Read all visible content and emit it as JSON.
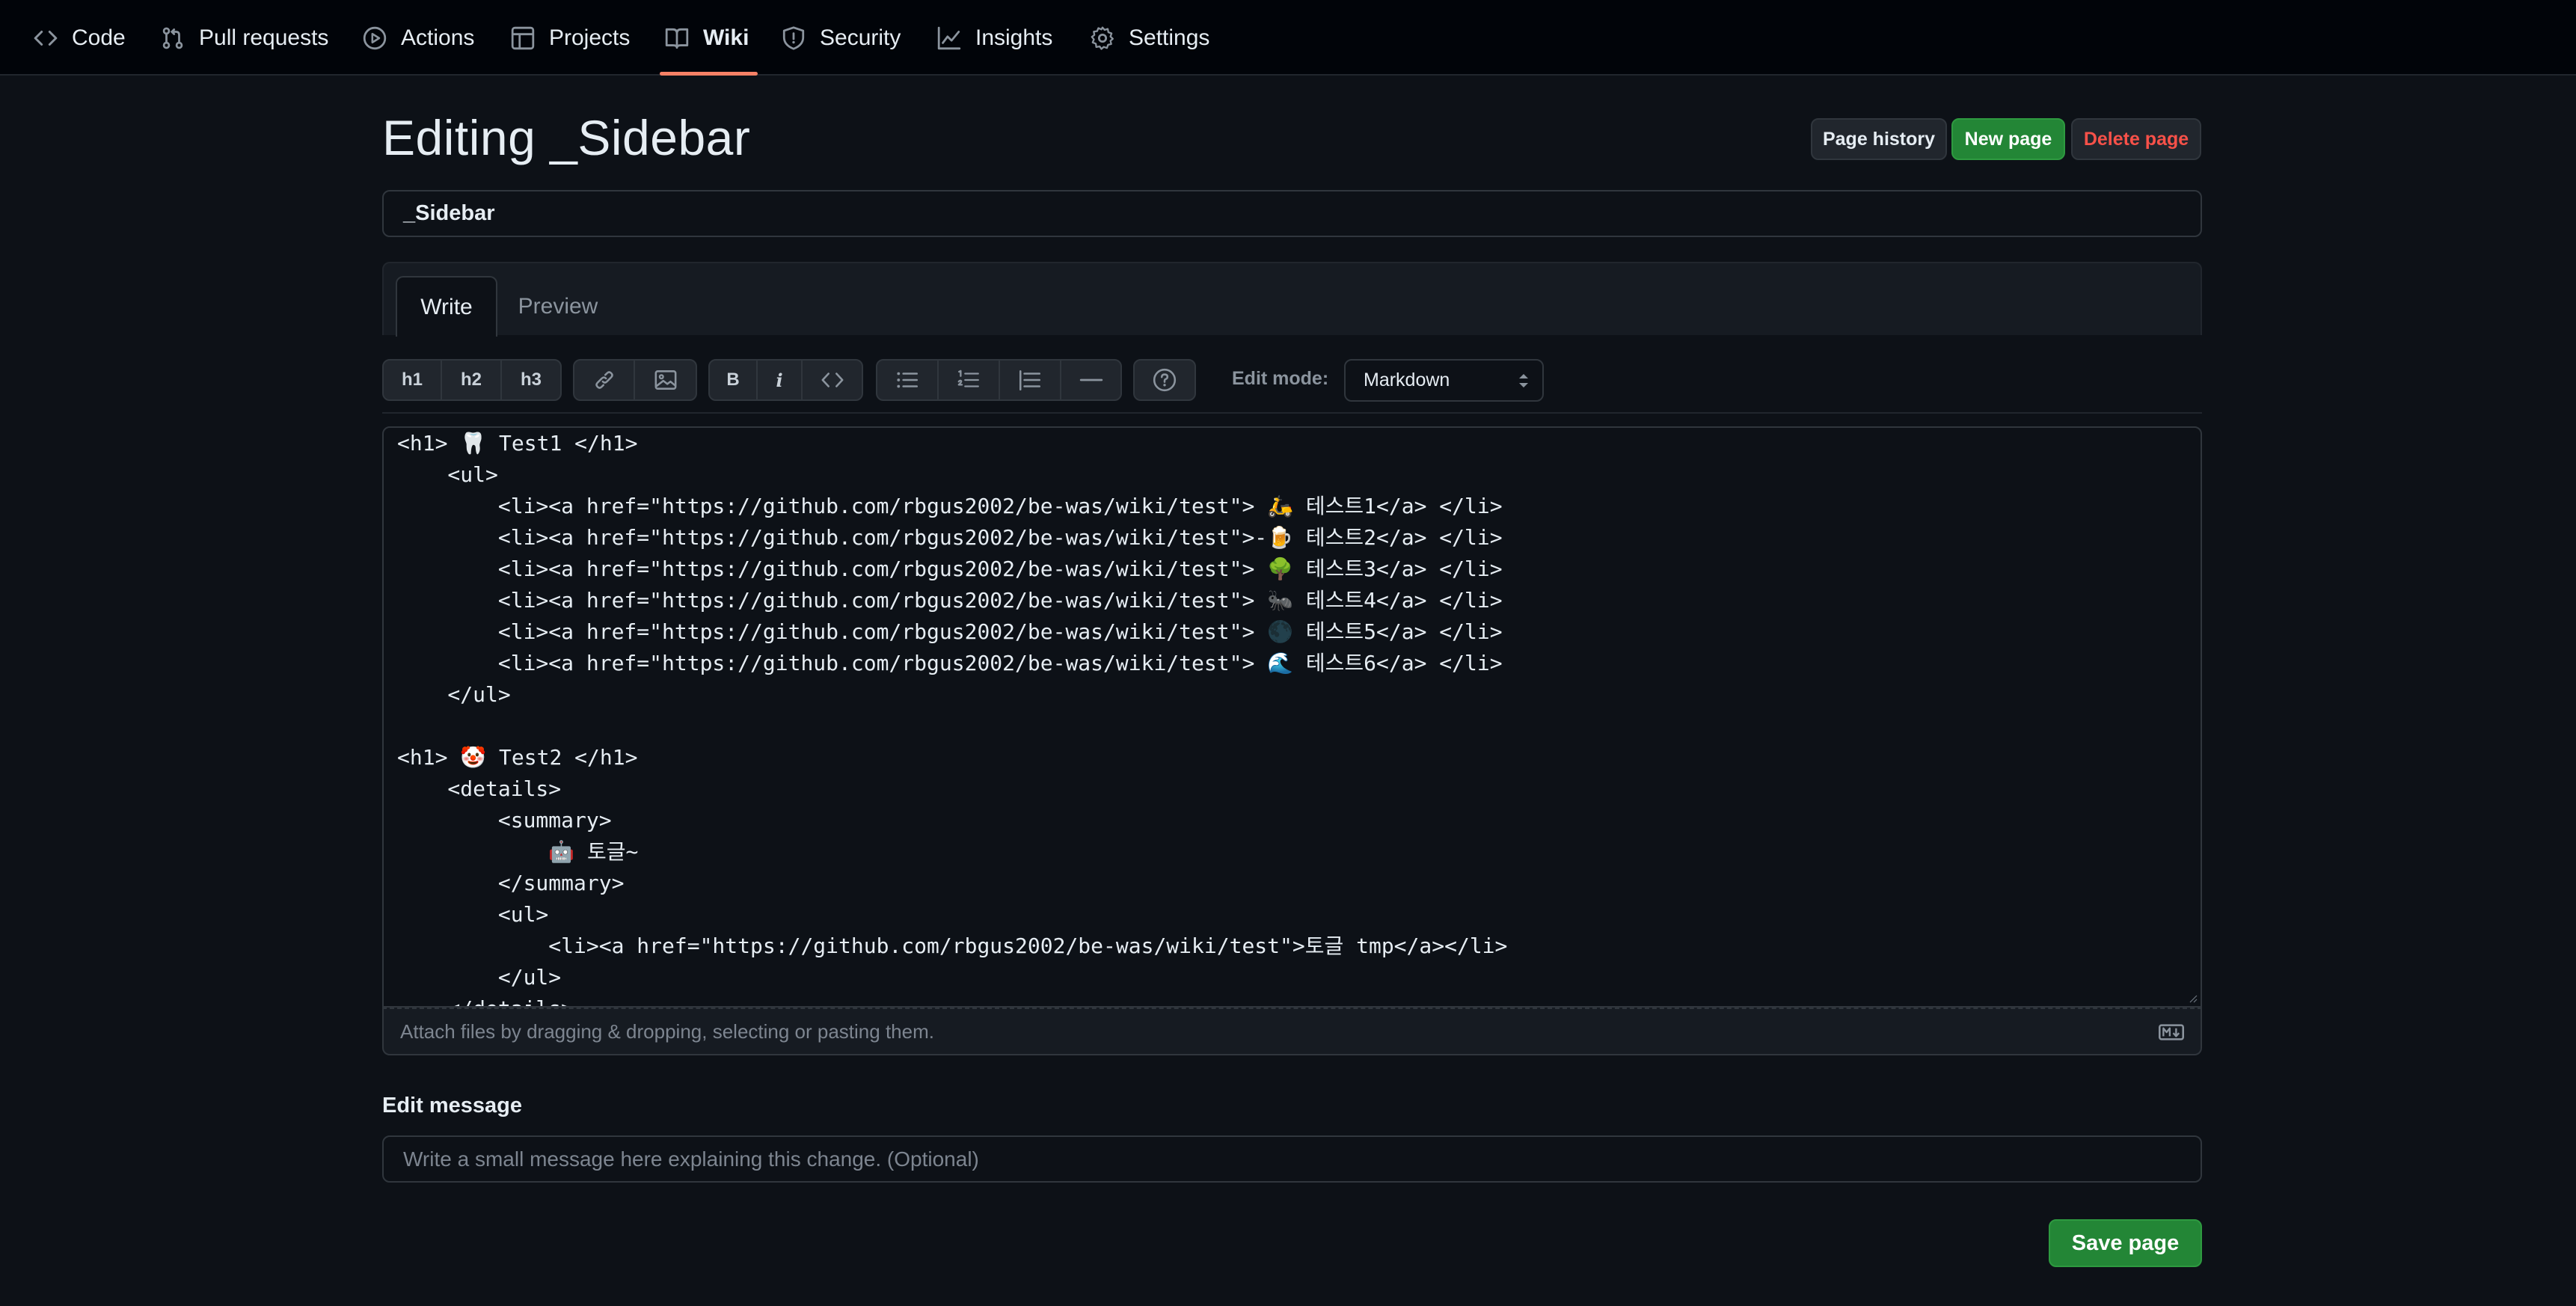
{
  "nav": {
    "items": [
      {
        "label": "Code",
        "icon": "code-icon"
      },
      {
        "label": "Pull requests",
        "icon": "pull-request-icon"
      },
      {
        "label": "Actions",
        "icon": "play-icon"
      },
      {
        "label": "Projects",
        "icon": "table-icon"
      },
      {
        "label": "Wiki",
        "icon": "book-icon",
        "active": true
      },
      {
        "label": "Security",
        "icon": "shield-icon"
      },
      {
        "label": "Insights",
        "icon": "graph-icon"
      },
      {
        "label": "Settings",
        "icon": "gear-icon"
      }
    ],
    "active_color": "#f78166"
  },
  "header": {
    "title": "Editing _Sidebar",
    "page_history": "Page history",
    "new_page": "New page",
    "delete_page": "Delete page"
  },
  "page_name": "_Sidebar",
  "tabs": {
    "write": "Write",
    "preview": "Preview"
  },
  "toolbar": {
    "h1": "h1",
    "h2": "h2",
    "h3": "h3",
    "bold": "B",
    "italic": "i",
    "edit_mode_label": "Edit mode:",
    "edit_mode_value": "Markdown"
  },
  "editor": {
    "lines": [
      "<h1> 🦷 Test1 </h1>",
      "    <ul>",
      "        <li><a href=\"https://github.com/rbgus2002/be-was/wiki/test\"> 🛵 테스트1</a> </li>",
      "        <li><a href=\"https://github.com/rbgus2002/be-was/wiki/test\">-🍺 테스트2</a> </li>",
      "        <li><a href=\"https://github.com/rbgus2002/be-was/wiki/test\"> 🌳 테스트3</a> </li>",
      "        <li><a href=\"https://github.com/rbgus2002/be-was/wiki/test\"> 🐜 테스트4</a> </li>",
      "        <li><a href=\"https://github.com/rbgus2002/be-was/wiki/test\"> 🌑 테스트5</a> </li>",
      "        <li><a href=\"https://github.com/rbgus2002/be-was/wiki/test\"> 🌊 테스트6</a> </li>",
      "    </ul>",
      "",
      "<h1> 🤡 Test2 </h1>",
      "    <details>",
      "        <summary>",
      "            🤖 토글~",
      "        </summary>",
      "        <ul>",
      "            <li><a href=\"https://github.com/rbgus2002/be-was/wiki/test\">토글 tmp</a></li>",
      "        </ul>",
      "    </details>"
    ],
    "attach_hint": "Attach files by dragging & dropping, selecting or pasting them.",
    "markdown_badge_icon": "markdown-icon"
  },
  "edit_message": {
    "label": "Edit message",
    "placeholder": "Write a small message here explaining this change. (Optional)"
  },
  "save_label": "Save page",
  "colors": {
    "background": "#0d1117",
    "nav_background": "#010409",
    "primary_button": "#238636",
    "danger_text": "#f85149",
    "border": "#30363d"
  }
}
